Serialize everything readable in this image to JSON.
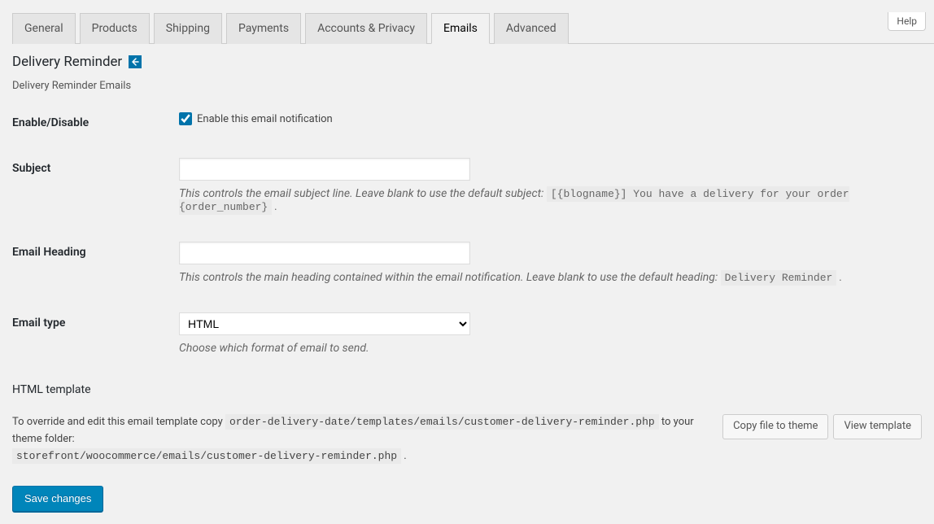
{
  "help_tab": "Help",
  "tabs": [
    {
      "label": "General"
    },
    {
      "label": "Products"
    },
    {
      "label": "Shipping"
    },
    {
      "label": "Payments"
    },
    {
      "label": "Accounts & Privacy"
    },
    {
      "label": "Emails"
    },
    {
      "label": "Advanced"
    }
  ],
  "page": {
    "title": "Delivery Reminder",
    "subtitle": "Delivery Reminder Emails"
  },
  "form": {
    "enable": {
      "label": "Enable/Disable",
      "checkbox_label": "Enable this email notification"
    },
    "subject": {
      "label": "Subject",
      "value": "",
      "desc_prefix": "This controls the email subject line. Leave blank to use the default subject: ",
      "desc_code": "[{blogname}] You have a delivery for your order {order_number}",
      "desc_suffix": " ."
    },
    "heading": {
      "label": "Email Heading",
      "value": "",
      "desc_prefix": "This controls the main heading contained within the email notification. Leave blank to use the default heading: ",
      "desc_code": "Delivery Reminder",
      "desc_suffix": " ."
    },
    "email_type": {
      "label": "Email type",
      "value": "HTML",
      "desc": "Choose which format of email to send."
    }
  },
  "template": {
    "title": "HTML template",
    "text_1": "To override and edit this email template copy ",
    "code_1": "order-delivery-date/templates/emails/customer-delivery-reminder.php",
    "text_2": " to your theme folder: ",
    "code_2": "storefront/woocommerce/emails/customer-delivery-reminder.php",
    "text_3": " .",
    "copy_btn": "Copy file to theme",
    "view_btn": "View template"
  },
  "save_button": "Save changes"
}
